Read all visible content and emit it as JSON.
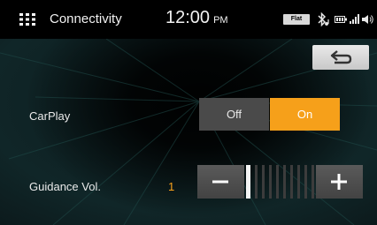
{
  "status_bar": {
    "title": "Connectivity",
    "time": "12:00",
    "ampm": "PM",
    "eq_badge": "Flat",
    "icons": [
      "menu-grid-icon",
      "bluetooth-audio-icon",
      "battery-icon",
      "signal-icon",
      "volume-icon"
    ]
  },
  "back_button": {
    "icon": "back-arrow-icon"
  },
  "carplay": {
    "label": "CarPlay",
    "off_label": "Off",
    "on_label": "On",
    "selected": "On"
  },
  "guidance_volume": {
    "label": "Guidance Vol.",
    "value": "1",
    "level": 1,
    "max_level": 11
  },
  "colors": {
    "accent": "#f6a01a",
    "button_gray": "#4a4a4a",
    "text": "#ffffff"
  }
}
